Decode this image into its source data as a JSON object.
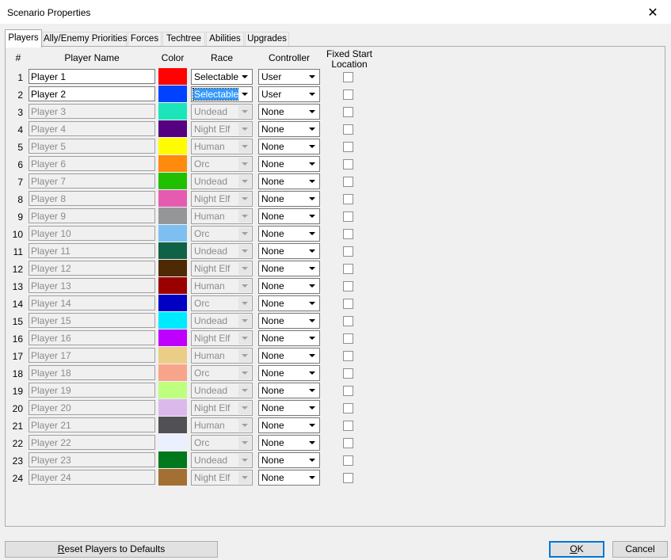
{
  "window": {
    "title": "Scenario Properties"
  },
  "tabs": [
    "Players",
    "Ally/Enemy Priorities",
    "Forces",
    "Techtree",
    "Abilities",
    "Upgrades"
  ],
  "headers": {
    "num": "#",
    "name": "Player Name",
    "color": "Color",
    "race": "Race",
    "controller": "Controller",
    "fixed_start_line1": "Fixed Start",
    "fixed_start_line2": "Location"
  },
  "players": [
    {
      "num": "1",
      "name": "Player 1",
      "color": "#ff0303",
      "race": "Selectable",
      "controller": "User",
      "enabled": true
    },
    {
      "num": "2",
      "name": "Player 2",
      "color": "#0042ff",
      "race": "Selectable",
      "controller": "User",
      "enabled": true,
      "race_selected": true
    },
    {
      "num": "3",
      "name": "Player 3",
      "color": "#1ce6b9",
      "race": "Undead",
      "controller": "None",
      "enabled": false
    },
    {
      "num": "4",
      "name": "Player 4",
      "color": "#540081",
      "race": "Night Elf",
      "controller": "None",
      "enabled": false
    },
    {
      "num": "5",
      "name": "Player 5",
      "color": "#fffc01",
      "race": "Human",
      "controller": "None",
      "enabled": false
    },
    {
      "num": "6",
      "name": "Player 6",
      "color": "#fe8a0e",
      "race": "Orc",
      "controller": "None",
      "enabled": false
    },
    {
      "num": "7",
      "name": "Player 7",
      "color": "#20c000",
      "race": "Undead",
      "controller": "None",
      "enabled": false
    },
    {
      "num": "8",
      "name": "Player 8",
      "color": "#e55bb0",
      "race": "Night Elf",
      "controller": "None",
      "enabled": false
    },
    {
      "num": "9",
      "name": "Player 9",
      "color": "#959697",
      "race": "Human",
      "controller": "None",
      "enabled": false
    },
    {
      "num": "10",
      "name": "Player 10",
      "color": "#7ebff1",
      "race": "Orc",
      "controller": "None",
      "enabled": false
    },
    {
      "num": "11",
      "name": "Player 11",
      "color": "#106246",
      "race": "Undead",
      "controller": "None",
      "enabled": false
    },
    {
      "num": "12",
      "name": "Player 12",
      "color": "#4e2a04",
      "race": "Night Elf",
      "controller": "None",
      "enabled": false
    },
    {
      "num": "13",
      "name": "Player 13",
      "color": "#9b0000",
      "race": "Human",
      "controller": "None",
      "enabled": false
    },
    {
      "num": "14",
      "name": "Player 14",
      "color": "#0000c3",
      "race": "Orc",
      "controller": "None",
      "enabled": false
    },
    {
      "num": "15",
      "name": "Player 15",
      "color": "#00eaff",
      "race": "Undead",
      "controller": "None",
      "enabled": false
    },
    {
      "num": "16",
      "name": "Player 16",
      "color": "#be00fe",
      "race": "Night Elf",
      "controller": "None",
      "enabled": false
    },
    {
      "num": "17",
      "name": "Player 17",
      "color": "#ebcd87",
      "race": "Human",
      "controller": "None",
      "enabled": false
    },
    {
      "num": "18",
      "name": "Player 18",
      "color": "#f8a48b",
      "race": "Orc",
      "controller": "None",
      "enabled": false
    },
    {
      "num": "19",
      "name": "Player 19",
      "color": "#bfff80",
      "race": "Undead",
      "controller": "None",
      "enabled": false
    },
    {
      "num": "20",
      "name": "Player 20",
      "color": "#dcb9eb",
      "race": "Night Elf",
      "controller": "None",
      "enabled": false
    },
    {
      "num": "21",
      "name": "Player 21",
      "color": "#505055",
      "race": "Human",
      "controller": "None",
      "enabled": false
    },
    {
      "num": "22",
      "name": "Player 22",
      "color": "#ebf0ff",
      "race": "Orc",
      "controller": "None",
      "enabled": false
    },
    {
      "num": "23",
      "name": "Player 23",
      "color": "#00781e",
      "race": "Undead",
      "controller": "None",
      "enabled": false
    },
    {
      "num": "24",
      "name": "Player 24",
      "color": "#a46f33",
      "race": "Night Elf",
      "controller": "None",
      "enabled": false
    }
  ],
  "buttons": {
    "reset_mnemonic": "R",
    "reset_rest": "eset Players to Defaults",
    "ok_mnemonic": "O",
    "ok_rest": "K",
    "cancel": "Cancel"
  },
  "icons": {
    "close": "close-icon",
    "dropdown": "chevron-down-icon"
  }
}
